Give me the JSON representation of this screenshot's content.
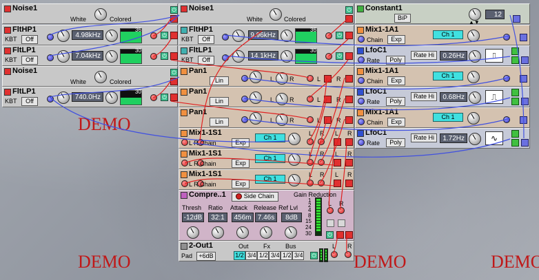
{
  "watermark": "DEMO",
  "colors": {
    "module_bg": "#c8c8c8",
    "accent_cyan": "#40e0e0",
    "jack_red": "#d02020",
    "jack_blue": "#3030c0",
    "demo_red": "#c01818"
  },
  "col1": {
    "noise_a": {
      "title": "Noise1",
      "left_label": "White",
      "right_label": "Colored"
    },
    "flthp": {
      "title": "FltHP1",
      "kbt_label": "KBT",
      "kbt_value": "Off",
      "freq": "4.98kHz",
      "slope": "36"
    },
    "fltlp": {
      "title": "FltLP1",
      "kbt_label": "KBT",
      "kbt_value": "Off",
      "freq": "7.04kHz",
      "slope": "30"
    },
    "noise_b": {
      "title": "Noise1",
      "left_label": "White",
      "right_label": "Colored"
    },
    "fltlp2": {
      "title": "FltLP1",
      "kbt_label": "KBT",
      "kbt_value": "Off",
      "freq": "740.0Hz",
      "slope": "30"
    }
  },
  "col2": {
    "noise": {
      "title": "Noise1",
      "left_label": "White",
      "right_label": "Colored"
    },
    "flthp": {
      "title": "FltHP1",
      "kbt_label": "KBT",
      "kbt_value": "Off",
      "freq": "9.96kHz",
      "slope": "36"
    },
    "fltlp": {
      "title": "FltLP1",
      "kbt_label": "KBT",
      "kbt_value": "Off",
      "freq": "14.1kHz",
      "slope": "30"
    },
    "pans": [
      {
        "title": "Pan1",
        "btn": "Lin",
        "l": "L",
        "r": "R"
      },
      {
        "title": "Pan1",
        "btn": "Lin",
        "l": "L",
        "r": "R"
      },
      {
        "title": "Pan1",
        "btn": "Lin",
        "l": "L",
        "r": "R"
      }
    ],
    "mix1s": [
      {
        "title": "Mix1-1S1",
        "chain": "L R Chain",
        "exp": "Exp",
        "ch": "Ch 1",
        "l": "L",
        "r": "R"
      },
      {
        "title": "Mix1-1S1",
        "chain": "L R Chain",
        "exp": "Exp",
        "ch": "Ch 1",
        "l": "L",
        "r": "R"
      },
      {
        "title": "Mix1-1S1",
        "chain": "L R Chain",
        "exp": "Exp",
        "ch": "Ch 1",
        "l": "L",
        "r": "R"
      }
    ],
    "compressor": {
      "title": "Compre..1",
      "side_chain": "Side Chain",
      "gain_reduction": "Gain Reduction",
      "params": [
        "Thresh",
        "Ratio",
        "Attack",
        "Release",
        "Ref Lvl"
      ],
      "values": [
        "-12dB",
        "32:1",
        "456m",
        "7.46s",
        "8dB"
      ],
      "scale": [
        "1",
        "2",
        "4",
        "8",
        "15",
        "24",
        "30"
      ],
      "l": "L",
      "r": "R"
    },
    "out": {
      "title": "2-Out1",
      "pad_label": "Pad",
      "pad_value": "+6dB",
      "out": "Out",
      "fx": "Fx",
      "bus": "Bus",
      "buttons": [
        "1/2",
        "3/4",
        "1/2",
        "3/4",
        "1/2",
        "3/4"
      ],
      "l": "L",
      "r": "R"
    }
  },
  "col3": {
    "constant": {
      "title": "Constant1",
      "bip": "BiP",
      "value": "12"
    },
    "mix1a": [
      {
        "title": "Mix1-1A1",
        "chain": "Chain",
        "exp": "Exp",
        "ch": "Ch 1"
      },
      {
        "title": "Mix1-1A1",
        "chain": "Chain",
        "exp": "Exp",
        "ch": "Ch 1"
      },
      {
        "title": "Mix1-1A1",
        "chain": "Chain",
        "exp": "Exp",
        "ch": "Ch 1"
      }
    ],
    "lfos": [
      {
        "title": "LfoC1",
        "rate_label": "Rate",
        "mode": "Poly",
        "range": "Rate Hi",
        "rate": "0.26Hz",
        "wave": "square"
      },
      {
        "title": "LfoC1",
        "rate_label": "Rate",
        "mode": "Poly",
        "range": "Rate Hi",
        "rate": "0.68Hz",
        "wave": "square"
      },
      {
        "title": "LfoC1",
        "rate_label": "Rate",
        "mode": "Poly",
        "range": "Rate Hi",
        "rate": "1.72Hz",
        "wave": "sine"
      }
    ]
  }
}
